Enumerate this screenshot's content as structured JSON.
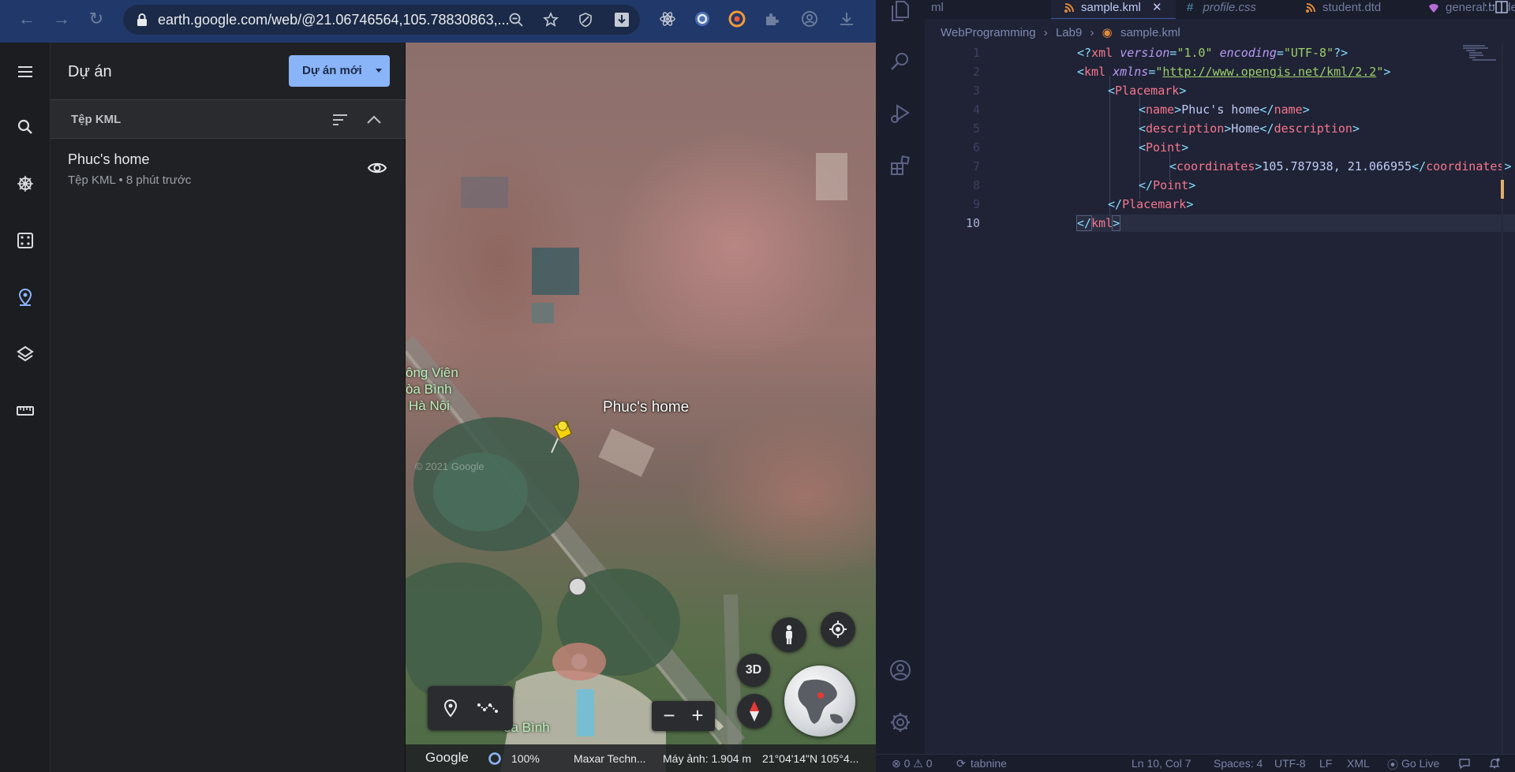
{
  "browser": {
    "url": "earth.google.com/web/@21.06746564,105.78830863,...",
    "nav": {
      "back": "←",
      "forward": "→",
      "reload": "↻"
    }
  },
  "earth": {
    "panel_title": "Dự án",
    "new_project_label": "Dự án mới",
    "section_label": "Tệp KML",
    "item": {
      "title": "Phuc's home",
      "subtitle": "Tệp KML • 8 phút trước"
    },
    "map": {
      "placemark_label": "Phuc's home",
      "park_label_lines": [
        "ông Viên",
        "òa Bình",
        "Hà Nội"
      ],
      "park_label_bottom": "òa Bình",
      "watermark": "© 2021 Google",
      "btn_3d": "3D",
      "zoom_out": "−",
      "zoom_in": "+"
    },
    "footer": {
      "brand": "Google",
      "percent": "100%",
      "credit": "Maxar Techn...",
      "camera": "Máy ảnh: 1.904 m",
      "coords": "21°04'14\"N 105°4..."
    }
  },
  "vscode": {
    "tabs": [
      {
        "label": "ml"
      },
      {
        "label": "sample.kml",
        "close": "✕"
      },
      {
        "label": "profile.css",
        "glyph": "#"
      },
      {
        "label": "student.dtd"
      },
      {
        "label": "general.blade"
      }
    ],
    "tab_more": "···",
    "breadcrumb": [
      "WebProgramming",
      "Lab9",
      "sample.kml"
    ],
    "line_numbers": [
      "1",
      "2",
      "3",
      "4",
      "5",
      "6",
      "7",
      "8",
      "9",
      "10"
    ],
    "code": {
      "l1": {
        "decl_open": "<?",
        "decl_name": "xml",
        "version_attr": "version",
        "version_val": "\"1.0\"",
        "enc_attr": "encoding",
        "enc_val": "\"UTF-8\"",
        "decl_close": "?>"
      },
      "l2": {
        "tag": "kml",
        "attr": "xmlns",
        "q1": "\"",
        "url": "http://www.opengis.net/kml/2.2",
        "q2": "\""
      },
      "l3": {
        "tag": "Placemark"
      },
      "l4": {
        "tag": "name",
        "text": "Phuc's home"
      },
      "l5": {
        "tag": "description",
        "text": "Home"
      },
      "l6": {
        "tag": "Point"
      },
      "l7": {
        "tag": "coordinates",
        "text": "105.787938, 21.066955"
      },
      "l8": {
        "tag": "Point"
      },
      "l9": {
        "tag": "Placemark"
      },
      "l10": {
        "tag": "kml"
      }
    },
    "status": {
      "problems": "⊗ 0 ⚠ 0",
      "tabnine": "tabnine",
      "position": "Ln 10, Col 7",
      "spaces": "Spaces: 4",
      "encoding": "UTF-8",
      "eol": "LF",
      "language": "XML",
      "golive": "Go Live"
    }
  }
}
